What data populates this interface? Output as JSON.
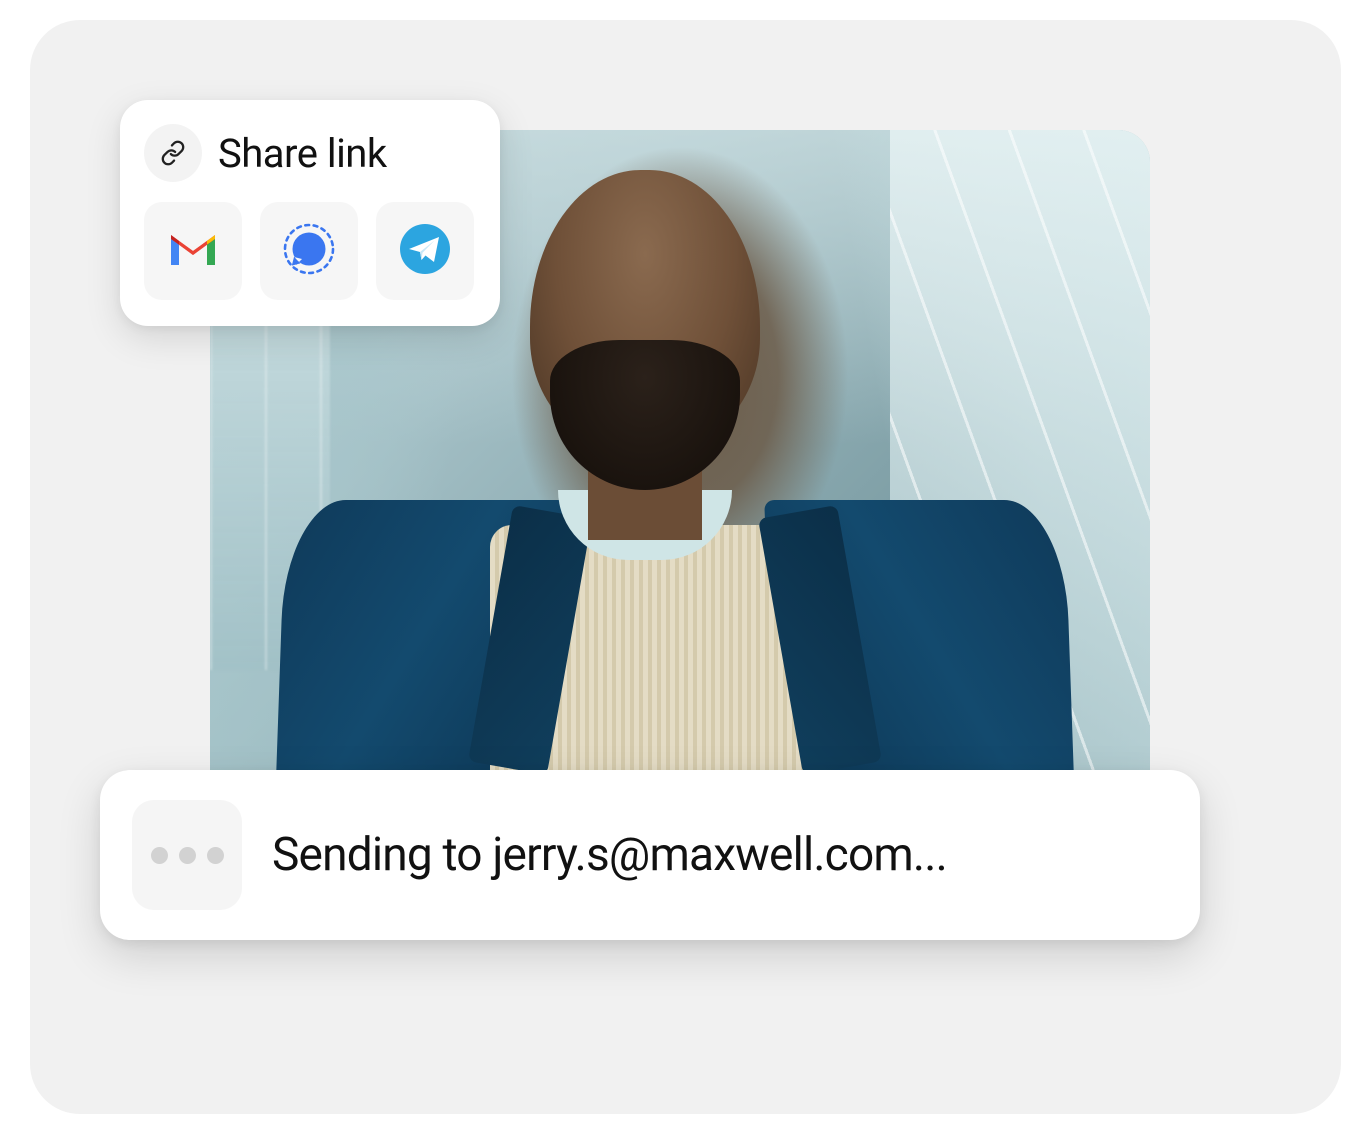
{
  "share": {
    "title": "Share link",
    "apps": {
      "gmail": "gmail-icon",
      "signal": "signal-icon",
      "telegram": "telegram-icon"
    }
  },
  "sending": {
    "text": "Sending to jerry.s@maxwell.com..."
  },
  "colors": {
    "card_bg": "#ffffff",
    "canvas_bg": "#f1f1f1",
    "tile_bg": "#f6f6f6",
    "telegram": "#2ca5e0",
    "signal": "#3a76f0",
    "gmail_red": "#ea4335",
    "gmail_yellow": "#fbbc05",
    "gmail_green": "#34a853",
    "gmail_blue": "#4285f4"
  }
}
